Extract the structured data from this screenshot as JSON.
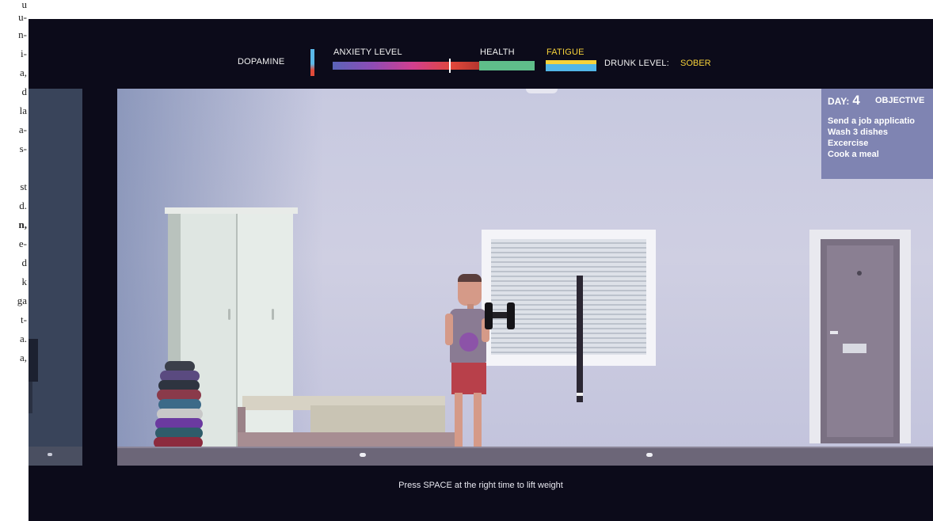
{
  "magazine_fragments": [
    "u",
    "u-",
    "n-",
    "i-",
    "a,",
    "d",
    "la",
    "a-",
    "s-",
    "st",
    "d.",
    "n,",
    "e-",
    "d",
    "k",
    "ga",
    "t-",
    "a.",
    "a,"
  ],
  "hud": {
    "dopamine_label": "DOPAMINE",
    "anxiety_label": "ANXIETY LEVEL",
    "health_label": "HEALTH",
    "fatigue_label": "FATIGUE",
    "drunk_label": "DRUNK LEVEL:",
    "drunk_value": "SOBER",
    "anxiety_level": 0.73,
    "colors": {
      "health": "#5fbe8a",
      "fatigue_top": "#f6d23a",
      "fatigue_bottom": "#52b6e8",
      "yellow_text": "#f6d23a"
    }
  },
  "objectives": {
    "day_label": "DAY:",
    "day_number": "4",
    "title": "OBJECTIVE",
    "items": [
      "Send a job applicatio",
      "Wash 3 dishes",
      "Excercise",
      "Cook a meal"
    ]
  },
  "prompt": "Press SPACE at the right time to lift weight"
}
